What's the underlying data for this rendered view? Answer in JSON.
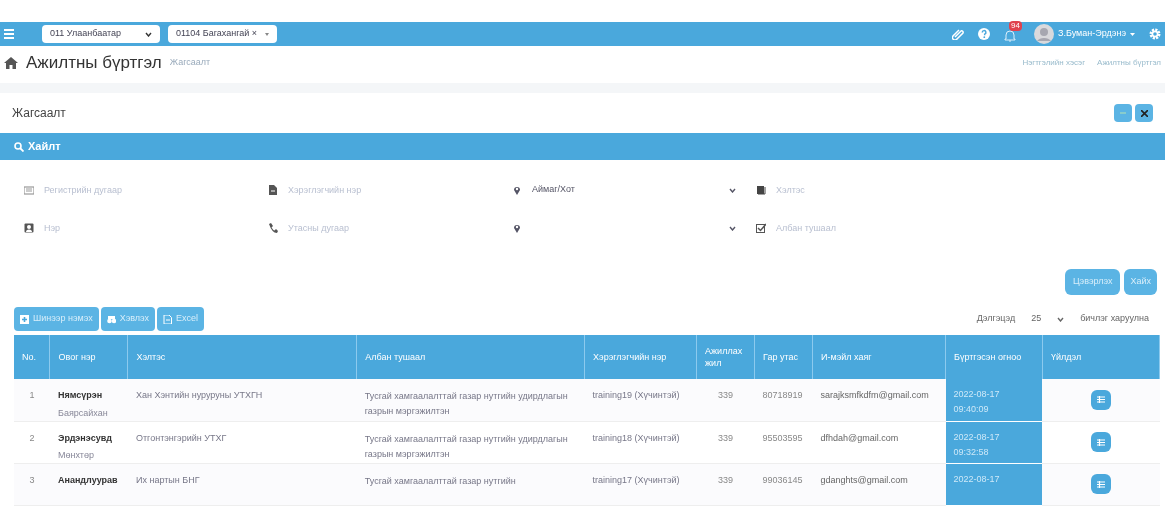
{
  "navbar": {
    "selects": [
      {
        "value": "011  Улаанбаатар",
        "kind": "select"
      },
      {
        "value": "01104  Багахангай ×",
        "kind": "tag"
      }
    ],
    "notification_count": "94",
    "user_name": "З.Буман-Эрдэнэ"
  },
  "page": {
    "title": "Ажилтны бүртгэл",
    "subtitle": "Жагсаалт",
    "breadcrumbs": [
      "Нэгтгэлийн хэсэг",
      "Ажилтны бүртгэл"
    ]
  },
  "panel": {
    "title": "Жагсаалт",
    "search_title": "Хайлт"
  },
  "filters": [
    {
      "placeholder": "Регистрийн дугаар",
      "kind": "text"
    },
    {
      "placeholder": "Хэрэглэгчийн нэр",
      "kind": "text"
    },
    {
      "value": "Аймаг/Хот",
      "kind": "select"
    },
    {
      "placeholder": "Хэлтэс",
      "kind": "text"
    },
    {
      "placeholder": "Нэр",
      "kind": "text"
    },
    {
      "placeholder": "Утасны дугаар",
      "kind": "text"
    },
    {
      "kind": "select"
    },
    {
      "placeholder": "Албан тушаал",
      "kind": "text"
    }
  ],
  "filter_buttons": [
    "Цэвэрлэх",
    "Хайх"
  ],
  "toolbar": [
    "Шинээр нэмэх",
    "Хэвлэх",
    "Excel"
  ],
  "page_size": {
    "before": "Дэлгэцэд",
    "value": "25",
    "after": "бичлэг харуулна"
  },
  "table": {
    "columns": [
      "No.",
      "Овог нэр",
      "Хэлтэс",
      "Албан тушаал",
      "Хэрэглэгчийн нэр",
      "Ажиллах жил",
      "Гар утас",
      "И-мэйл хаяг",
      "Бүртгэсэн огноо",
      "Үйлдэл"
    ],
    "rows": [
      {
        "no": "1",
        "name": "Нямсүрэн",
        "surname": "Баярсайхан",
        "department": "Хан Хэнтийн нуруруны УТХГН",
        "position": "Тусгай хамгаалалттай газар нутгийн удирдлагын газрын мэргэжилтэн",
        "username": "training19 (Хүчинтэй)",
        "years": "339",
        "phone": "80718919",
        "email": "sarajksmfkdfm@gmail.com",
        "date": "2022-08-17 09:40:09"
      },
      {
        "no": "2",
        "name": "Эрдэнэсувд",
        "surname": "Мөнхтөр",
        "department": "Отгонтэнгэрийн УТХГ",
        "position": "Тусгай хамгаалалттай газар нутгийн удирдлагын газрын мэргэжилтэн",
        "username": "training18 (Хүчинтэй)",
        "years": "339",
        "phone": "95503595",
        "email": "dfhdah@gmail.com",
        "date": "2022-08-17 09:32:58"
      },
      {
        "no": "3",
        "name": "Анандлуурав",
        "surname": "",
        "department": "Их нартын БНГ",
        "position": "Тусгай хамгаалалттай газар нутгийн",
        "username": "training17 (Хүчинтэй)",
        "years": "339",
        "phone": "99036145",
        "email": "gdanghts@gmail.com",
        "date": "2022-08-17"
      }
    ]
  }
}
